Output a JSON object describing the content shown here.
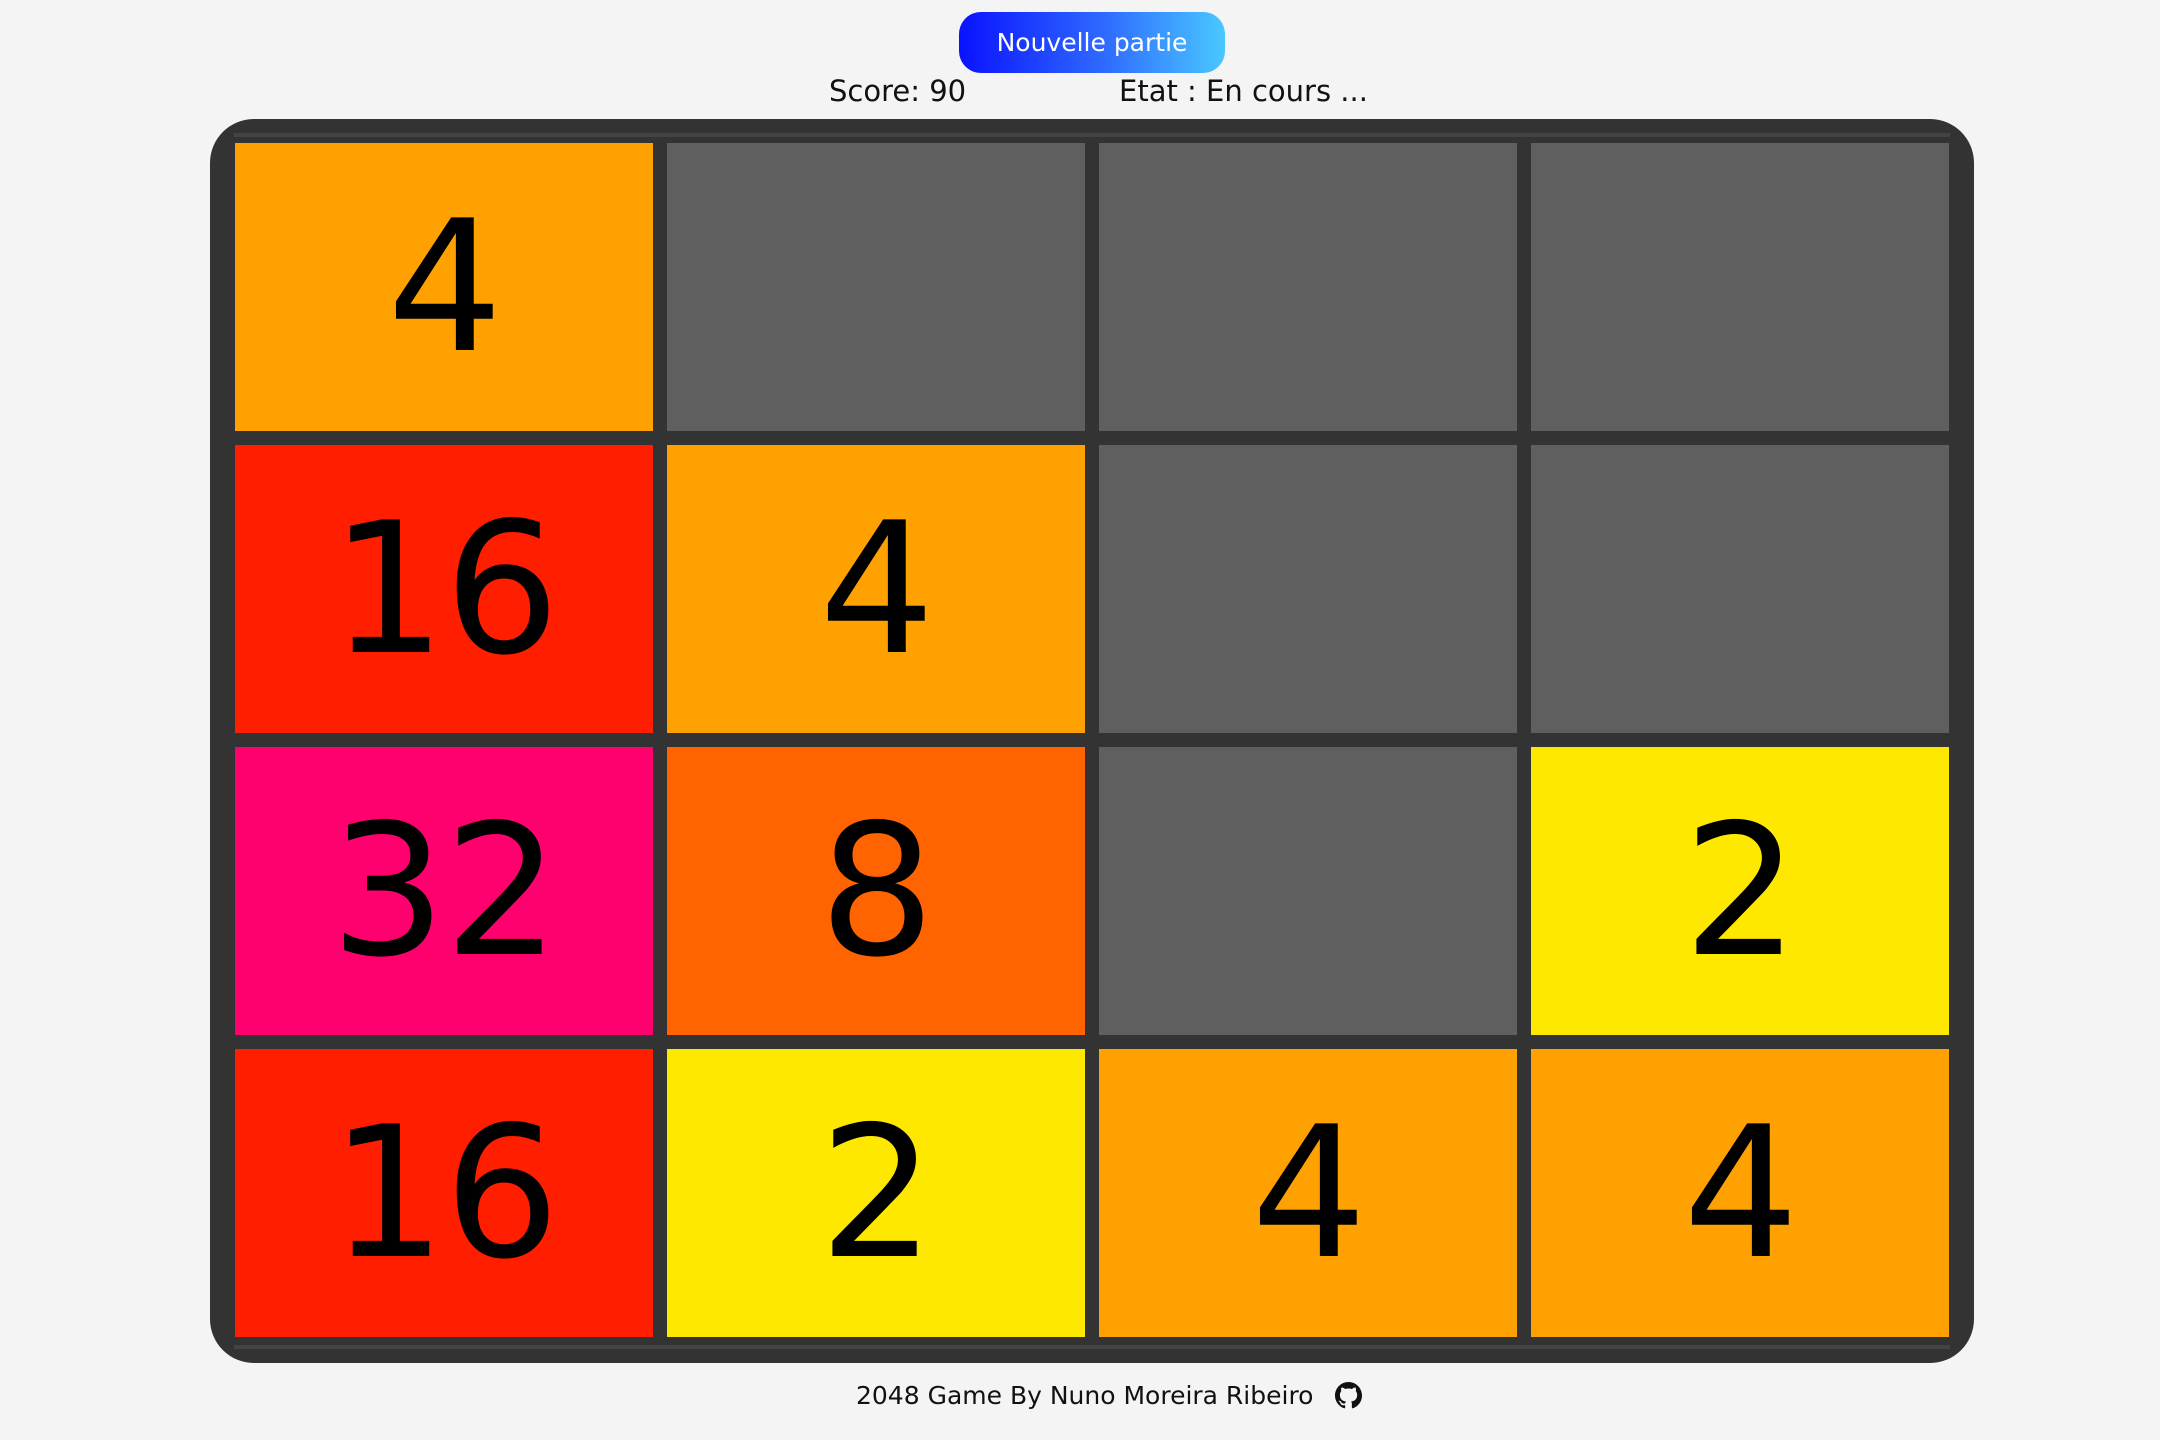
{
  "header": {
    "new_game_label": "Nouvelle partie",
    "score_text": "Score: 90",
    "state_text": "Etat : En cours ..."
  },
  "game": {
    "score": 90,
    "state": "En cours",
    "grid": [
      [
        4,
        0,
        0,
        0
      ],
      [
        16,
        4,
        0,
        0
      ],
      [
        32,
        8,
        0,
        2
      ],
      [
        16,
        2,
        4,
        4
      ]
    ],
    "colors": {
      "empty": "#5f5f5f",
      "2": "#ffe800",
      "4": "#ffa100",
      "8": "#ff6400",
      "16": "#ff1e00",
      "32": "#ff006e",
      "board": "#333333"
    }
  },
  "footer": {
    "credit": "2048 Game By Nuno Moreira Ribeiro",
    "link_icon": "github-icon"
  }
}
